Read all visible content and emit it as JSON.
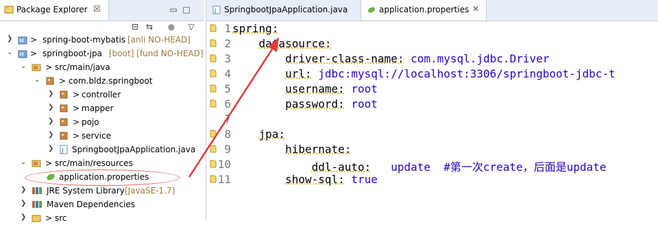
{
  "package_explorer": {
    "title": "Package Explorer",
    "close": "☒",
    "tree": [
      {
        "label": "spring-boot-mybatis",
        "suffix": "[anli NO-HEAD]",
        "prefix": ">",
        "expanded": false
      },
      {
        "label": "springboot-jpa",
        "suffix": "[boot] [fund NO-HEAD]",
        "prefix": ">",
        "expanded": true
      },
      {
        "label": "src/main/java",
        "prefix": ">"
      },
      {
        "label": "com.bldz.springboot",
        "prefix": ">"
      },
      {
        "label": "controller",
        "prefix": ">"
      },
      {
        "label": "mapper",
        "prefix": ">"
      },
      {
        "label": "pojo",
        "prefix": ">"
      },
      {
        "label": "service",
        "prefix": ">"
      },
      {
        "label": "SpringbootJpaApplication.java",
        "prefix": ""
      },
      {
        "label": "src/main/resources",
        "prefix": ">"
      },
      {
        "label": "application.properties",
        "prefix": ""
      },
      {
        "label": "JRE System Library",
        "suffix": "[JavaSE-1.7]",
        "prefix": ""
      },
      {
        "label": "Maven Dependencies",
        "prefix": ""
      },
      {
        "label": "src",
        "prefix": ">"
      }
    ]
  },
  "editor": {
    "tabs": [
      {
        "label": "SpringbootJpaApplication.java",
        "active": false
      },
      {
        "label": "application.properties",
        "active": true
      }
    ],
    "lines": [
      {
        "n": "1",
        "indent": "",
        "key": "spring:",
        "val": ""
      },
      {
        "n": "2",
        "indent": "    ",
        "key": "datasource:",
        "val": ""
      },
      {
        "n": "3",
        "indent": "        ",
        "key": "driver-class-name:",
        "val": " com.mysql.jdbc.Driver"
      },
      {
        "n": "4",
        "indent": "        ",
        "key": "url:",
        "val": " jdbc:mysql://localhost:3306/springboot-jdbc-t"
      },
      {
        "n": "5",
        "indent": "        ",
        "key": "username:",
        "val": " root"
      },
      {
        "n": "6",
        "indent": "        ",
        "key": "password:",
        "val": " root"
      },
      {
        "n": "7",
        "indent": "",
        "key": "",
        "val": ""
      },
      {
        "n": "8",
        "indent": "    ",
        "key": "jpa:",
        "val": ""
      },
      {
        "n": "9",
        "indent": "        ",
        "key": "hibernate:",
        "val": ""
      },
      {
        "n": "10",
        "indent": "            ",
        "key": "ddl-auto:",
        "val": "   update  #第一次create，后面是update"
      },
      {
        "n": "11",
        "indent": "        ",
        "key": "show-sql:",
        "val": " true"
      }
    ]
  },
  "colors": {
    "annotation": "#e23a3a",
    "value": "#2a00c8"
  }
}
